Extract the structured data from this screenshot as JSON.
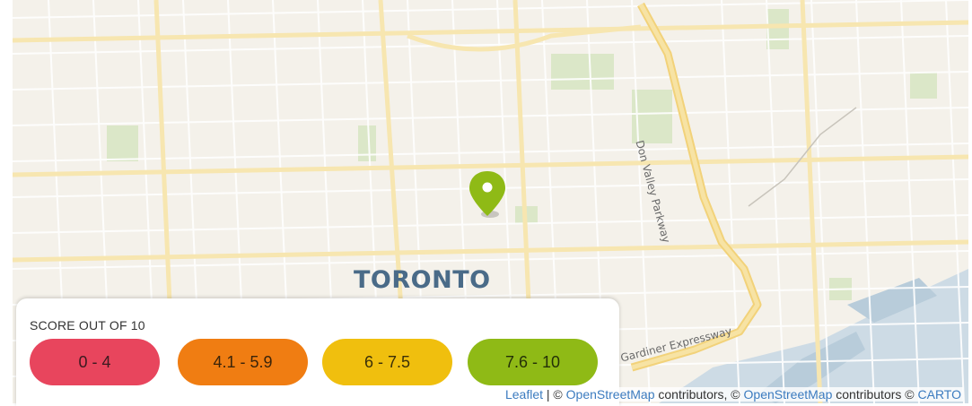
{
  "map": {
    "city_label": "TORONTO",
    "roads": {
      "dvp": "Don Valley Parkway",
      "gardiner": "Gardiner Expressway"
    },
    "marker_icon": "map-pin-icon",
    "marker_color": "#8fba16",
    "water_color": "#c8d8e4",
    "park_color": "#d6e4c2",
    "highway_color": "#f5dc8e"
  },
  "legend": {
    "title": "SCORE OUT OF 10",
    "ranges": [
      {
        "label": "0 - 4",
        "color": "#e8455d"
      },
      {
        "label": "4.1 - 5.9",
        "color": "#f07d12"
      },
      {
        "label": "6 - 7.5",
        "color": "#f0bf0e"
      },
      {
        "label": "7.6 - 10",
        "color": "#8fba16"
      }
    ]
  },
  "attribution": {
    "leaflet": "Leaflet",
    "sep1": " | © ",
    "osm1": "OpenStreetMap",
    "text1": " contributors, © ",
    "osm2": "OpenStreetMap",
    "text2": " contributors © ",
    "carto": "CARTO"
  }
}
